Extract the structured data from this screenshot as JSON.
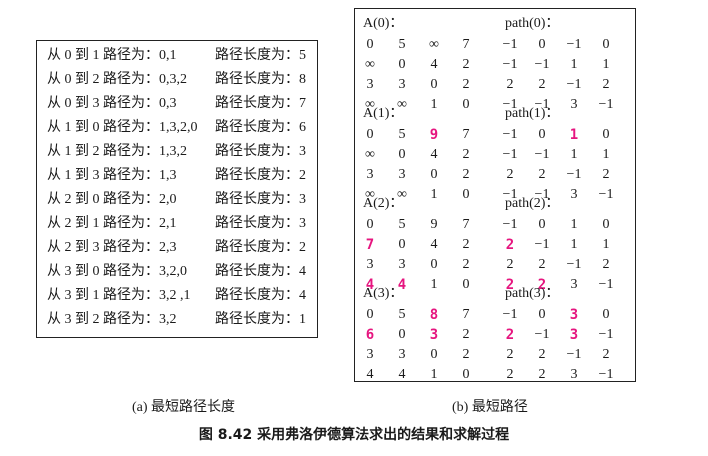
{
  "left": {
    "rows": [
      {
        "path": "从 0 到 1 路径为：0,1",
        "len": "路径长度为：5"
      },
      {
        "path": "从 0 到 2 路径为：0,3,2",
        "len": "路径长度为：8"
      },
      {
        "path": "从 0 到 3 路径为：0,3",
        "len": "路径长度为：7"
      },
      {
        "path": "从 1 到 0 路径为：1,3,2,0",
        "len": "路径长度为：6"
      },
      {
        "path": "从 1 到 2 路径为：1,3,2",
        "len": "路径长度为：3"
      },
      {
        "path": "从 1 到 3 路径为：1,3",
        "len": "路径长度为：2"
      },
      {
        "path": "从 2 到 0 路径为：2,0",
        "len": "路径长度为：3"
      },
      {
        "path": "从 2 到 1 路径为：2,1",
        "len": "路径长度为：3"
      },
      {
        "path": "从 2 到 3 路径为：2,3",
        "len": "路径长度为：2"
      },
      {
        "path": "从 3 到 0 路径为：3,2,0",
        "len": "路径长度为：4"
      },
      {
        "path": "从 3 到 1 路径为：3,2 ,1",
        "len": "路径长度为：4"
      },
      {
        "path": "从 3 到 2 路径为：3,2",
        "len": "路径长度为：1"
      }
    ]
  },
  "right": {
    "sections": [
      {
        "a_label": "A(0)：",
        "p_label": "path(0)：",
        "rows": [
          {
            "a": [
              "0",
              "5",
              "∞",
              "7"
            ],
            "p": [
              "−1",
              "0",
              "−1",
              "0"
            ]
          },
          {
            "a": [
              "∞",
              "0",
              "4",
              "2"
            ],
            "p": [
              "−1",
              "−1",
              "1",
              "1"
            ]
          },
          {
            "a": [
              "3",
              "3",
              "0",
              "2"
            ],
            "p": [
              "2",
              "2",
              "−1",
              "2"
            ]
          },
          {
            "a": [
              "∞",
              "∞",
              "1",
              "0"
            ],
            "p": [
              "−1",
              "−1",
              "3",
              "−1"
            ]
          }
        ]
      },
      {
        "a_label": "A(1)：",
        "p_label": "path(1)：",
        "rows": [
          {
            "a": [
              "0",
              "5",
              "9",
              "7"
            ],
            "p": [
              "−1",
              "0",
              "1",
              "0"
            ]
          },
          {
            "a": [
              "∞",
              "0",
              "4",
              "2"
            ],
            "p": [
              "−1",
              "−1",
              "1",
              "1"
            ]
          },
          {
            "a": [
              "3",
              "3",
              "0",
              "2"
            ],
            "p": [
              "2",
              "2",
              "−1",
              "2"
            ]
          },
          {
            "a": [
              "∞",
              "∞",
              "1",
              "0"
            ],
            "p": [
              "−1",
              "−1",
              "3",
              "−1"
            ]
          }
        ]
      },
      {
        "a_label": "A(2)：",
        "p_label": "path(2)：",
        "rows": [
          {
            "a": [
              "0",
              "5",
              "9",
              "7"
            ],
            "p": [
              "−1",
              "0",
              "1",
              "0"
            ]
          },
          {
            "a": [
              "7",
              "0",
              "4",
              "2"
            ],
            "p": [
              "2",
              "−1",
              "1",
              "1"
            ]
          },
          {
            "a": [
              "3",
              "3",
              "0",
              "2"
            ],
            "p": [
              "2",
              "2",
              "−1",
              "2"
            ]
          },
          {
            "a": [
              "4",
              "4",
              "1",
              "0"
            ],
            "p": [
              "2",
              "2",
              "3",
              "−1"
            ]
          }
        ]
      },
      {
        "a_label": "A(3)：",
        "p_label": "path(3)：",
        "rows": [
          {
            "a": [
              "0",
              "5",
              "8",
              "7"
            ],
            "p": [
              "−1",
              "0",
              "3",
              "0"
            ]
          },
          {
            "a": [
              "6",
              "0",
              "3",
              "2"
            ],
            "p": [
              "2",
              "−1",
              "3",
              "−1"
            ]
          },
          {
            "a": [
              "3",
              "3",
              "0",
              "2"
            ],
            "p": [
              "2",
              "2",
              "−1",
              "2"
            ]
          },
          {
            "a": [
              "4",
              "4",
              "1",
              "0"
            ],
            "p": [
              "2",
              "2",
              "3",
              "−1"
            ]
          }
        ]
      }
    ]
  },
  "captions": {
    "left": "(a)  最短路径长度",
    "right": "(b)  最短路径",
    "figure": "图 8.42   采用弗洛伊德算法求出的结果和求解过程"
  }
}
